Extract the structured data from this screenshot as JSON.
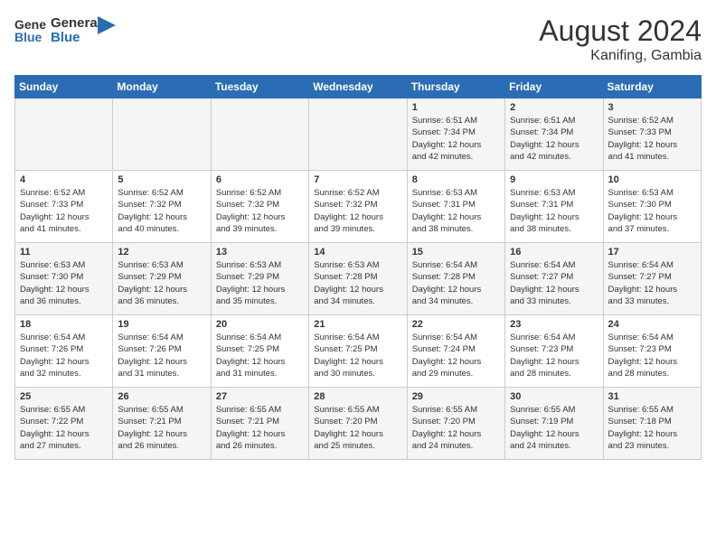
{
  "header": {
    "logo_general": "General",
    "logo_blue": "Blue",
    "month_year": "August 2024",
    "location": "Kanifing, Gambia"
  },
  "days_of_week": [
    "Sunday",
    "Monday",
    "Tuesday",
    "Wednesday",
    "Thursday",
    "Friday",
    "Saturday"
  ],
  "weeks": [
    [
      {
        "day": "",
        "info": ""
      },
      {
        "day": "",
        "info": ""
      },
      {
        "day": "",
        "info": ""
      },
      {
        "day": "",
        "info": ""
      },
      {
        "day": "1",
        "info": "Sunrise: 6:51 AM\nSunset: 7:34 PM\nDaylight: 12 hours\nand 42 minutes."
      },
      {
        "day": "2",
        "info": "Sunrise: 6:51 AM\nSunset: 7:34 PM\nDaylight: 12 hours\nand 42 minutes."
      },
      {
        "day": "3",
        "info": "Sunrise: 6:52 AM\nSunset: 7:33 PM\nDaylight: 12 hours\nand 41 minutes."
      }
    ],
    [
      {
        "day": "4",
        "info": "Sunrise: 6:52 AM\nSunset: 7:33 PM\nDaylight: 12 hours\nand 41 minutes."
      },
      {
        "day": "5",
        "info": "Sunrise: 6:52 AM\nSunset: 7:32 PM\nDaylight: 12 hours\nand 40 minutes."
      },
      {
        "day": "6",
        "info": "Sunrise: 6:52 AM\nSunset: 7:32 PM\nDaylight: 12 hours\nand 39 minutes."
      },
      {
        "day": "7",
        "info": "Sunrise: 6:52 AM\nSunset: 7:32 PM\nDaylight: 12 hours\nand 39 minutes."
      },
      {
        "day": "8",
        "info": "Sunrise: 6:53 AM\nSunset: 7:31 PM\nDaylight: 12 hours\nand 38 minutes."
      },
      {
        "day": "9",
        "info": "Sunrise: 6:53 AM\nSunset: 7:31 PM\nDaylight: 12 hours\nand 38 minutes."
      },
      {
        "day": "10",
        "info": "Sunrise: 6:53 AM\nSunset: 7:30 PM\nDaylight: 12 hours\nand 37 minutes."
      }
    ],
    [
      {
        "day": "11",
        "info": "Sunrise: 6:53 AM\nSunset: 7:30 PM\nDaylight: 12 hours\nand 36 minutes."
      },
      {
        "day": "12",
        "info": "Sunrise: 6:53 AM\nSunset: 7:29 PM\nDaylight: 12 hours\nand 36 minutes."
      },
      {
        "day": "13",
        "info": "Sunrise: 6:53 AM\nSunset: 7:29 PM\nDaylight: 12 hours\nand 35 minutes."
      },
      {
        "day": "14",
        "info": "Sunrise: 6:53 AM\nSunset: 7:28 PM\nDaylight: 12 hours\nand 34 minutes."
      },
      {
        "day": "15",
        "info": "Sunrise: 6:54 AM\nSunset: 7:28 PM\nDaylight: 12 hours\nand 34 minutes."
      },
      {
        "day": "16",
        "info": "Sunrise: 6:54 AM\nSunset: 7:27 PM\nDaylight: 12 hours\nand 33 minutes."
      },
      {
        "day": "17",
        "info": "Sunrise: 6:54 AM\nSunset: 7:27 PM\nDaylight: 12 hours\nand 33 minutes."
      }
    ],
    [
      {
        "day": "18",
        "info": "Sunrise: 6:54 AM\nSunset: 7:26 PM\nDaylight: 12 hours\nand 32 minutes."
      },
      {
        "day": "19",
        "info": "Sunrise: 6:54 AM\nSunset: 7:26 PM\nDaylight: 12 hours\nand 31 minutes."
      },
      {
        "day": "20",
        "info": "Sunrise: 6:54 AM\nSunset: 7:25 PM\nDaylight: 12 hours\nand 31 minutes."
      },
      {
        "day": "21",
        "info": "Sunrise: 6:54 AM\nSunset: 7:25 PM\nDaylight: 12 hours\nand 30 minutes."
      },
      {
        "day": "22",
        "info": "Sunrise: 6:54 AM\nSunset: 7:24 PM\nDaylight: 12 hours\nand 29 minutes."
      },
      {
        "day": "23",
        "info": "Sunrise: 6:54 AM\nSunset: 7:23 PM\nDaylight: 12 hours\nand 28 minutes."
      },
      {
        "day": "24",
        "info": "Sunrise: 6:54 AM\nSunset: 7:23 PM\nDaylight: 12 hours\nand 28 minutes."
      }
    ],
    [
      {
        "day": "25",
        "info": "Sunrise: 6:55 AM\nSunset: 7:22 PM\nDaylight: 12 hours\nand 27 minutes."
      },
      {
        "day": "26",
        "info": "Sunrise: 6:55 AM\nSunset: 7:21 PM\nDaylight: 12 hours\nand 26 minutes."
      },
      {
        "day": "27",
        "info": "Sunrise: 6:55 AM\nSunset: 7:21 PM\nDaylight: 12 hours\nand 26 minutes."
      },
      {
        "day": "28",
        "info": "Sunrise: 6:55 AM\nSunset: 7:20 PM\nDaylight: 12 hours\nand 25 minutes."
      },
      {
        "day": "29",
        "info": "Sunrise: 6:55 AM\nSunset: 7:20 PM\nDaylight: 12 hours\nand 24 minutes."
      },
      {
        "day": "30",
        "info": "Sunrise: 6:55 AM\nSunset: 7:19 PM\nDaylight: 12 hours\nand 24 minutes."
      },
      {
        "day": "31",
        "info": "Sunrise: 6:55 AM\nSunset: 7:18 PM\nDaylight: 12 hours\nand 23 minutes."
      }
    ]
  ]
}
